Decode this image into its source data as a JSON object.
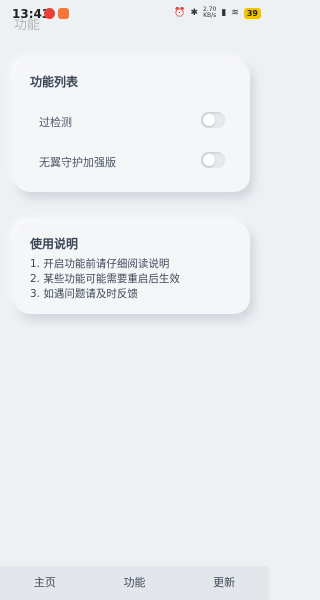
{
  "status_bar": {
    "time": "13:43",
    "ghost_text": "功能",
    "speed_value": "2.70",
    "speed_unit": "KB/s",
    "battery": "39",
    "icons": [
      "weibo-icon",
      "notification-icon",
      "alarm-icon",
      "vibrate-icon",
      "signal-icon",
      "wifi-icon"
    ]
  },
  "features": {
    "title": "功能列表",
    "items": [
      {
        "label": "过检测",
        "enabled": false
      },
      {
        "label": "无翼守护加强版",
        "enabled": false
      }
    ]
  },
  "help": {
    "title": "使用说明",
    "items": [
      "1. 开启功能前请仔细阅读说明",
      "2. 某些功能可能需要重启后生效",
      "3. 如遇问题请及时反馈"
    ]
  },
  "bottom_nav": {
    "tabs": [
      {
        "label": "主页"
      },
      {
        "label": "功能"
      },
      {
        "label": "更新"
      }
    ]
  }
}
